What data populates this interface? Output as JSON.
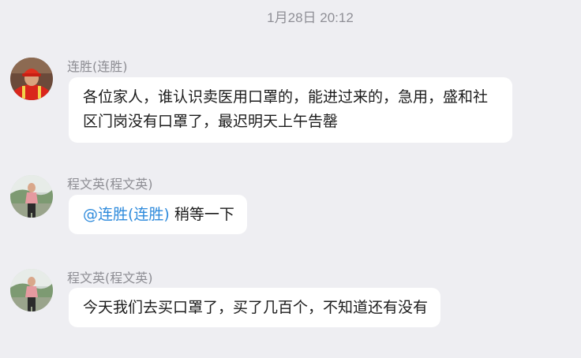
{
  "timestamp": "1月28日 20:12",
  "messages": [
    {
      "sender": "连胜(连胜)",
      "avatar": "avatar-red-worker",
      "text": "各位家人，谁认识卖医用口罩的，能进过来的，急用，盛和社区门岗没有口罩了，最迟明天上午告罄"
    },
    {
      "sender": "程文英(程文英)",
      "avatar": "avatar-woman-outdoors",
      "mention": "@连胜(连胜)",
      "text": " 稍等一下"
    },
    {
      "sender": "程文英(程文英)",
      "avatar": "avatar-woman-outdoors",
      "text": "今天我们去买口罩了，买了几百个，不知道还有没有"
    }
  ]
}
